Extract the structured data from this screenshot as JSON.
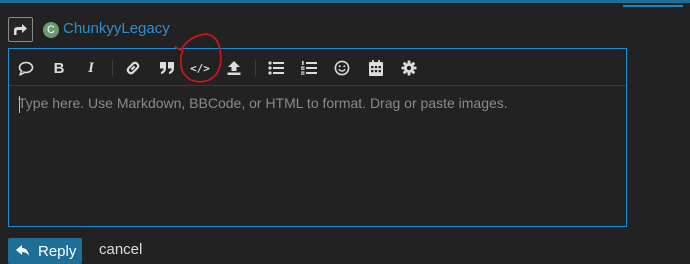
{
  "colors": {
    "background": "#222222",
    "accent": "#1e6f98",
    "editor_border": "#1b8bd3",
    "username": "#2f8ed0",
    "annotation": "#d0141c"
  },
  "composer": {
    "reply_to_icon": "share-arrow-icon",
    "avatar_letter": "C",
    "username": "ChunkyyLegacy"
  },
  "toolbar": {
    "buttons": [
      {
        "name": "quote-bubble",
        "icon": "speech-bubble-icon"
      },
      {
        "name": "bold",
        "glyph": "B"
      },
      {
        "name": "italic",
        "glyph": "I"
      },
      {
        "name": "link",
        "icon": "link-icon"
      },
      {
        "name": "blockquote",
        "glyph": "”"
      },
      {
        "name": "code",
        "glyph": "</>"
      },
      {
        "name": "upload",
        "icon": "upload-icon"
      },
      {
        "name": "bullet-list",
        "icon": "bullet-list-icon"
      },
      {
        "name": "numbered-list",
        "icon": "numbered-list-icon"
      },
      {
        "name": "emoji",
        "icon": "smiley-icon"
      },
      {
        "name": "date",
        "icon": "calendar-icon"
      },
      {
        "name": "options",
        "icon": "gear-icon"
      }
    ]
  },
  "editor": {
    "placeholder": "Type here. Use Markdown, BBCode, or HTML to format. Drag or paste images."
  },
  "footer": {
    "reply_label": "Reply",
    "cancel_label": "cancel"
  }
}
